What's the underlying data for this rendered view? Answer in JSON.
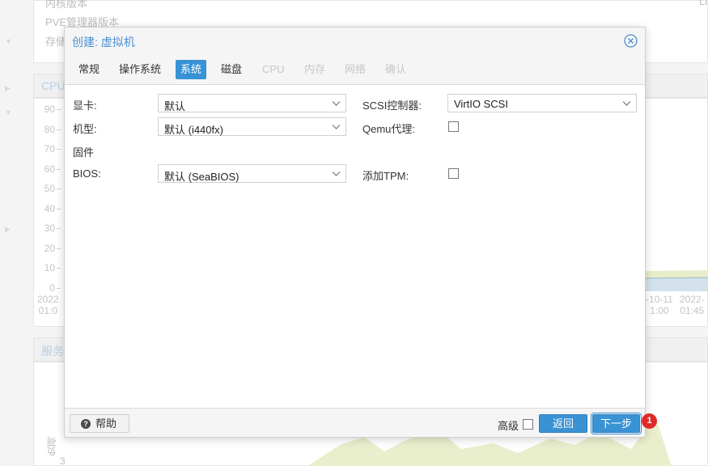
{
  "background": {
    "info_rows": [
      "内核版本",
      "PVE管理器版本",
      "存储"
    ],
    "info_right": "Li",
    "cpu_panel_title": "CPU",
    "service_panel_title": "服务",
    "y_ticks": [
      "90",
      "80",
      "70",
      "60",
      "50",
      "40",
      "30",
      "20",
      "10",
      "0"
    ],
    "x_ticks": [
      {
        "date": "2022",
        "time": "01:0"
      },
      {
        "date": "-10-11",
        "time": "1:00"
      },
      {
        "date": "2022-",
        "time": "01:45"
      }
    ],
    "load_axis_label": "负荷",
    "load_tick": "3"
  },
  "dialog": {
    "title": "创建: 虚拟机",
    "tabs": [
      {
        "label": "常规",
        "state": "normal"
      },
      {
        "label": "操作系统",
        "state": "normal"
      },
      {
        "label": "系统",
        "state": "active"
      },
      {
        "label": "磁盘",
        "state": "normal"
      },
      {
        "label": "CPU",
        "state": "disabled"
      },
      {
        "label": "内存",
        "state": "disabled"
      },
      {
        "label": "网络",
        "state": "disabled"
      },
      {
        "label": "确认",
        "state": "disabled"
      }
    ],
    "form": {
      "graphics_label": "显卡:",
      "graphics_value": "默认",
      "machine_label": "机型:",
      "machine_value": "默认 (i440fx)",
      "firmware_heading": "固件",
      "bios_label": "BIOS:",
      "bios_value": "默认 (SeaBIOS)",
      "scsi_label": "SCSI控制器:",
      "scsi_value": "VirtIO SCSI",
      "qemu_agent_label": "Qemu代理:",
      "qemu_agent_checked": false,
      "tpm_label": "添加TPM:",
      "tpm_checked": false
    },
    "footer": {
      "help_label": "帮助",
      "advanced_label": "高级",
      "advanced_checked": false,
      "back_label": "返回",
      "next_label": "下一步"
    }
  },
  "annotation": {
    "marker_number": "1",
    "marker_color": "#e02a2a"
  },
  "colors": {
    "accent": "#3892d4",
    "title": "#4c8fd0"
  }
}
